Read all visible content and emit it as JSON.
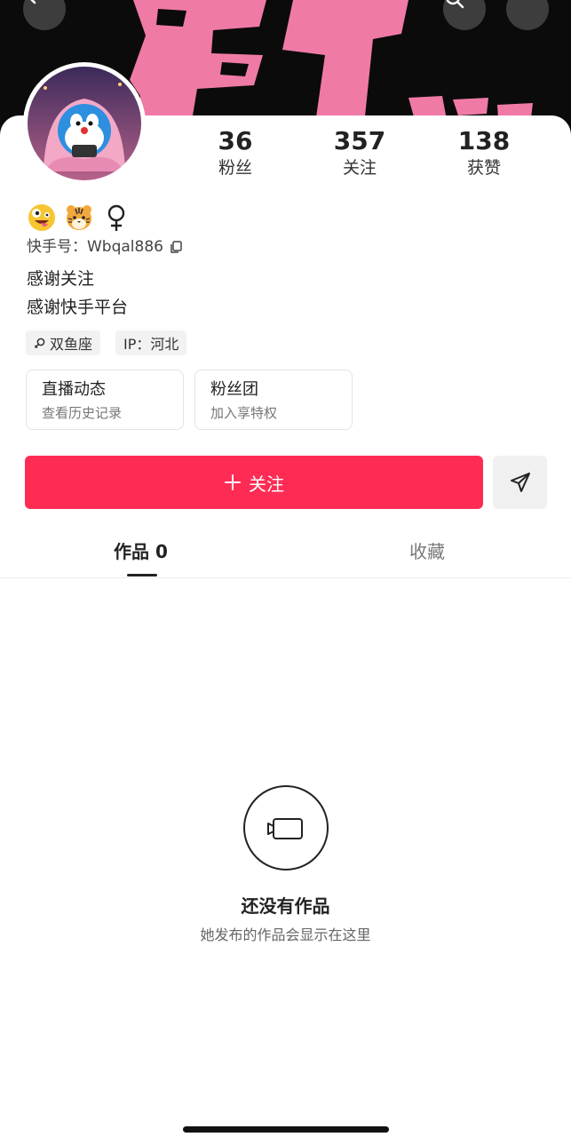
{
  "profile": {
    "kuaishou_id_label": "快手号：Wbqal886",
    "bio_lines": [
      "感谢关注",
      "感谢快手平台"
    ],
    "emojis": [
      "zany-face-emoji",
      "tiger-face-emoji",
      "female-sign"
    ],
    "tags": [
      {
        "icon": "female-sign-icon",
        "label": "双鱼座"
      },
      {
        "label": "IP：河北"
      }
    ]
  },
  "stats": [
    {
      "value": "36",
      "label": "粉丝"
    },
    {
      "value": "357",
      "label": "关注"
    },
    {
      "value": "138",
      "label": "获赞"
    }
  ],
  "features": [
    {
      "title": "直播动态",
      "subtitle": "查看历史记录"
    },
    {
      "title": "粉丝团",
      "subtitle": "加入享特权"
    }
  ],
  "actions": {
    "follow_label": "关注"
  },
  "tabs": [
    {
      "label": "作品 0",
      "active": true
    },
    {
      "label": "收藏",
      "active": false
    }
  ],
  "empty_state": {
    "title": "还没有作品",
    "subtitle": "她发布的作品会显示在这里"
  },
  "colors": {
    "accent": "#fe2c55",
    "banner_pink": "#f07aa6",
    "banner_bg": "#0b0b0b"
  }
}
